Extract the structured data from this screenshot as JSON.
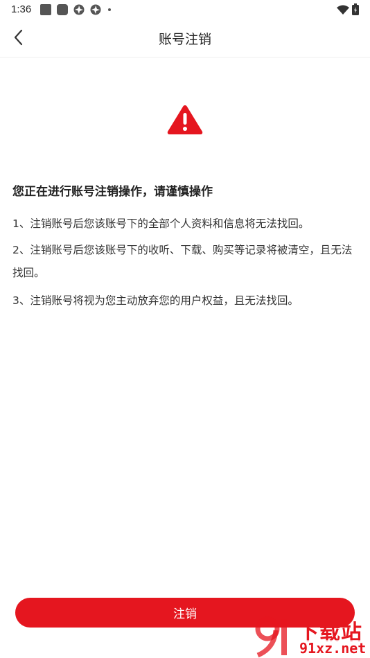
{
  "status_bar": {
    "time": "1:36"
  },
  "nav": {
    "title": "账号注销",
    "back_icon": "chevron-left-icon"
  },
  "notice": {
    "warning_icon": "warning-triangle-icon",
    "warning_color": "#e5161f",
    "heading": "您正在进行账号注销操作，请谨慎操作",
    "items": [
      "1、注销账号后您该账号下的全部个人资料和信息将无法找回。",
      "2、注销账号后您该账号下的收听、下载、购买等记录将被清空，且无法找回。",
      "3、注销账号将视为您主动放弃您的用户权益，且无法找回。"
    ]
  },
  "actions": {
    "cancel_label": "注销",
    "accent_color": "#e5161f"
  },
  "watermark": {
    "text_cn": "下载站",
    "text_en": "91xz.net"
  }
}
